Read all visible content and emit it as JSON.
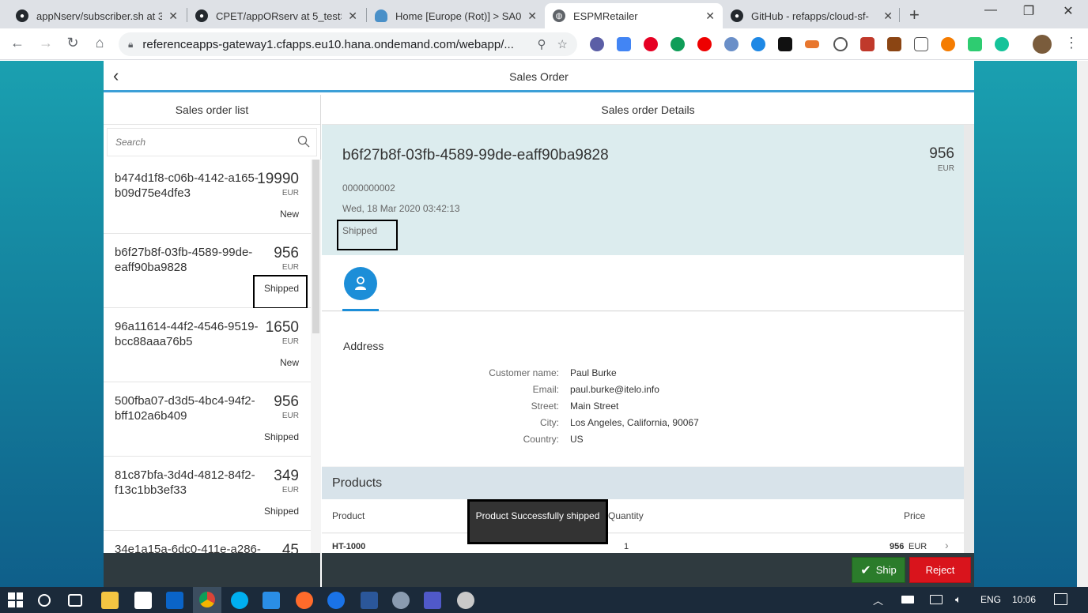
{
  "browser": {
    "tabs": [
      {
        "title": "appNserv/subscriber.sh at 3",
        "active": false
      },
      {
        "title": "CPET/appORserv at 5_testSi",
        "active": false
      },
      {
        "title": "Home [Europe (Rot)] > SA0",
        "active": false
      },
      {
        "title": "ESPMRetailer",
        "active": true
      },
      {
        "title": "GitHub - refapps/cloud-sf-",
        "active": false
      }
    ],
    "close_glyph": "✕",
    "new_tab": "+",
    "url": "referenceapps-gateway1.cfapps.eu10.hana.ondemand.com/webapp/..."
  },
  "app": {
    "title": "Sales Order",
    "master": {
      "title": "Sales order list",
      "search_placeholder": "Search",
      "items": [
        {
          "id": "b474d1f8-c06b-4142-a165-b09d75e4dfe3",
          "amount": "19990",
          "currency": "EUR",
          "status": "New"
        },
        {
          "id": "b6f27b8f-03fb-4589-99de-eaff90ba9828",
          "amount": "956",
          "currency": "EUR",
          "status": "Shipped"
        },
        {
          "id": "96a11614-44f2-4546-9519-bcc88aaa76b5",
          "amount": "1650",
          "currency": "EUR",
          "status": "New"
        },
        {
          "id": "500fba07-d3d5-4bc4-94f2-bff102a6b409",
          "amount": "956",
          "currency": "EUR",
          "status": "Shipped"
        },
        {
          "id": "81c87bfa-3d4d-4812-84f2-f13c1bb3ef33",
          "amount": "349",
          "currency": "EUR",
          "status": "Shipped"
        },
        {
          "id": "34e1a15a-6dc0-411e-a286-",
          "amount": "45",
          "currency": "",
          "status": ""
        }
      ]
    },
    "detail": {
      "title": "Sales order Details",
      "order_id": "b6f27b8f-03fb-4589-99de-eaff90ba9828",
      "order_number": "0000000002",
      "date": "Wed, 18 Mar 2020 03:42:13",
      "status": "Shipped",
      "amount": "956",
      "currency": "EUR",
      "address": {
        "title": "Address",
        "customer_name_label": "Customer name:",
        "customer_name": "Paul Burke",
        "email_label": "Email:",
        "email": "paul.burke@itelo.info",
        "street_label": "Street:",
        "street": "Main Street",
        "city_label": "City:",
        "city": "Los Angeles, California, 90067",
        "country_label": "Country:",
        "country": "US"
      },
      "products": {
        "title": "Products",
        "col_product": "Product",
        "col_quantity": "Quantity",
        "col_price": "Price",
        "rows": [
          {
            "product": "HT-1000",
            "quantity": "1",
            "price": "956",
            "currency": "EUR"
          }
        ]
      }
    },
    "toast": "Product Successfully shipped",
    "footer": {
      "ship_label": "Ship",
      "reject_label": "Reject"
    }
  },
  "taskbar": {
    "language": "ENG",
    "time": "10:06"
  }
}
